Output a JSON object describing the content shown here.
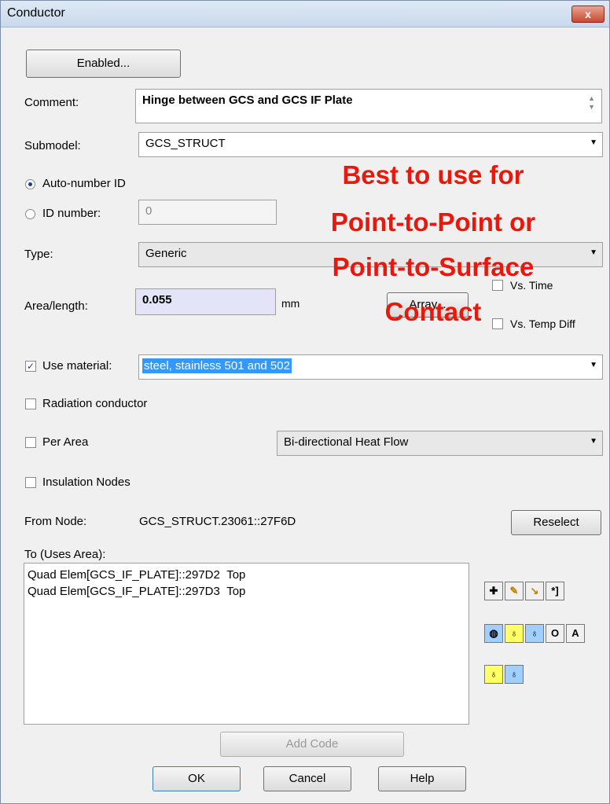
{
  "window": {
    "title": "Conductor",
    "close_glyph": "x"
  },
  "enabled_button": "Enabled...",
  "comment": {
    "label": "Comment:",
    "value": "Hinge between GCS and GCS IF Plate"
  },
  "submodel": {
    "label": "Submodel:",
    "value": "GCS_STRUCT"
  },
  "id": {
    "auto_label": "Auto-number ID",
    "number_label": "ID number:",
    "number_value": "0",
    "auto_selected": true
  },
  "type": {
    "label": "Type:",
    "value": "Generic"
  },
  "area": {
    "label": "Area/length:",
    "value": "0.055",
    "unit": "mm",
    "array_button": "Array...",
    "vs_time": "Vs. Time",
    "vs_temp": "Vs. Temp Diff"
  },
  "use_material": {
    "label": "Use material:",
    "value": "steel, stainless 501 and 502",
    "checked": true
  },
  "radiation": {
    "label": "Radiation conductor",
    "checked": false
  },
  "per_area": {
    "label": "Per Area",
    "checked": false,
    "flow_value": "Bi-directional Heat Flow"
  },
  "insulation": {
    "label": "Insulation Nodes",
    "checked": false
  },
  "from_node": {
    "label": "From Node:",
    "value": "GCS_STRUCT.23061::27F6D",
    "reselect": "Reselect"
  },
  "to_list": {
    "label": "To (Uses Area):",
    "items": [
      {
        "name": "Quad Elem[GCS_IF_PLATE]::297D2",
        "side": "Top"
      },
      {
        "name": "Quad Elem[GCS_IF_PLATE]::297D3",
        "side": "Top"
      }
    ]
  },
  "toolbar_icons": [
    "add-icon",
    "edit-icon",
    "select-icon",
    "star-icon",
    "node-globe-icon",
    "bulb-t-icon",
    "bulb-t2-icon",
    "o-icon",
    "a-icon",
    "bulb-2-3-icon",
    "bulb-2-3b-icon"
  ],
  "footer": {
    "add_code": "Add Code",
    "ok": "OK",
    "cancel": "Cancel",
    "help": "Help"
  },
  "annotation": {
    "lines": [
      "Best to use for",
      "Point-to-Point or",
      "Point-to-Surface",
      "Contact"
    ],
    "color": "#e8180c"
  }
}
